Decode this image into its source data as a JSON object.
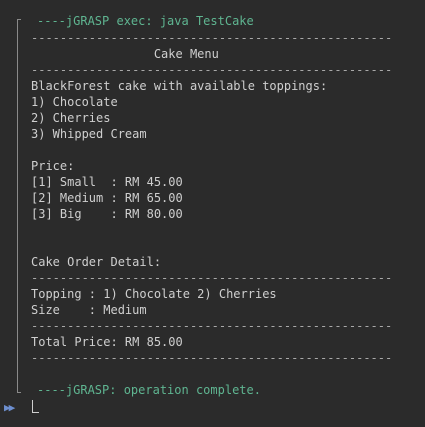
{
  "console": {
    "exec_line": "----jGRASP exec: java TestCake",
    "lines": [
      "--------------------------------------------------",
      "                 Cake Menu",
      "--------------------------------------------------",
      "BlackForest cake with available toppings:",
      "1) Chocolate",
      "2) Cherries",
      "3) Whipped Cream",
      "",
      "Price:",
      "[1] Small  : RM 45.00",
      "[2] Medium : RM 65.00",
      "[3] Big    : RM 80.00",
      "",
      "",
      "Cake Order Detail:",
      "--------------------------------------------------",
      "Topping : 1) Chocolate 2) Cherries",
      "Size    : Medium",
      "--------------------------------------------------",
      "Total Price: RM 85.00",
      "--------------------------------------------------"
    ],
    "complete_line": "----jGRASP: operation complete.",
    "prompt_icon": "run-arrows-icon"
  }
}
